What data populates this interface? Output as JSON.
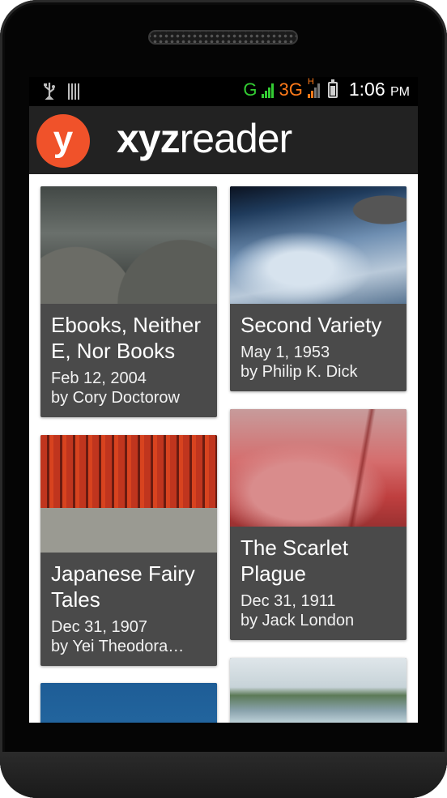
{
  "status_bar": {
    "network_g": "G",
    "network_3g": "3G",
    "network_h": "H",
    "time": "1:06",
    "ampm": "PM"
  },
  "action_bar": {
    "logo_letter": "y",
    "title_bold": "xyz",
    "title_rest": "reader"
  },
  "articles": [
    {
      "title": "Ebooks, Neither E, Nor Books",
      "date": "Feb 12, 2004",
      "author": "by Cory Doctorow",
      "thumbnail": "opera-house-roof"
    },
    {
      "title": "Second Variety",
      "date": "May 1, 1953",
      "author": "by Philip K. Dick",
      "thumbnail": "earth-from-space"
    },
    {
      "title": "Japanese Fairy Tales",
      "date": "Dec 31, 1907",
      "author": "by Yei Theodora…",
      "thumbnail": "torii-gates"
    },
    {
      "title": "The Scarlet Plague",
      "date": "Dec 31, 1911",
      "author": "by Jack London",
      "thumbnail": "bridge-in-red-fog"
    },
    {
      "title": "",
      "date": "",
      "author": "",
      "thumbnail": "blue-sky"
    },
    {
      "title": "",
      "date": "",
      "author": "",
      "thumbnail": "lake-and-trees"
    }
  ],
  "colors": {
    "accent": "#f0522a",
    "action_bar": "#222222",
    "card": "#4a4a4a",
    "network_g": "#33cc33",
    "network_3g": "#ff7a1a"
  }
}
